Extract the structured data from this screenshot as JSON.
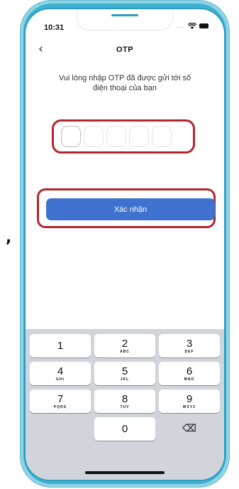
{
  "status_bar": {
    "time": "10:31",
    "signal_dots": "....",
    "wifi_icon": "wifi-icon",
    "battery_icon": "battery-icon"
  },
  "nav": {
    "back_icon": "‹",
    "title": "OTP"
  },
  "instruction": {
    "line1": "Vui lòng nhập OTP đã được gửi tới số",
    "line2": "điện thoại của bạn"
  },
  "otp": {
    "length": 5,
    "values": [
      "",
      "",
      "",
      "",
      ""
    ]
  },
  "confirm_button": {
    "label": "Xác nhận"
  },
  "keypad": {
    "keys": [
      {
        "num": "1",
        "letters": ""
      },
      {
        "num": "2",
        "letters": "ABC"
      },
      {
        "num": "3",
        "letters": "DEF"
      },
      {
        "num": "4",
        "letters": "GHI"
      },
      {
        "num": "5",
        "letters": "JKL"
      },
      {
        "num": "6",
        "letters": "MNO"
      },
      {
        "num": "7",
        "letters": "PQRS"
      },
      {
        "num": "8",
        "letters": "TUV"
      },
      {
        "num": "9",
        "letters": "WXYZ"
      },
      {
        "num": "0",
        "letters": ""
      }
    ],
    "delete_icon": "⌫"
  },
  "annotation": {
    "comma": ","
  },
  "colors": {
    "frame": "#3fb0cf",
    "highlight": "#b3262e",
    "button": "#3f72cf",
    "keypad_bg": "#d1d4da"
  }
}
